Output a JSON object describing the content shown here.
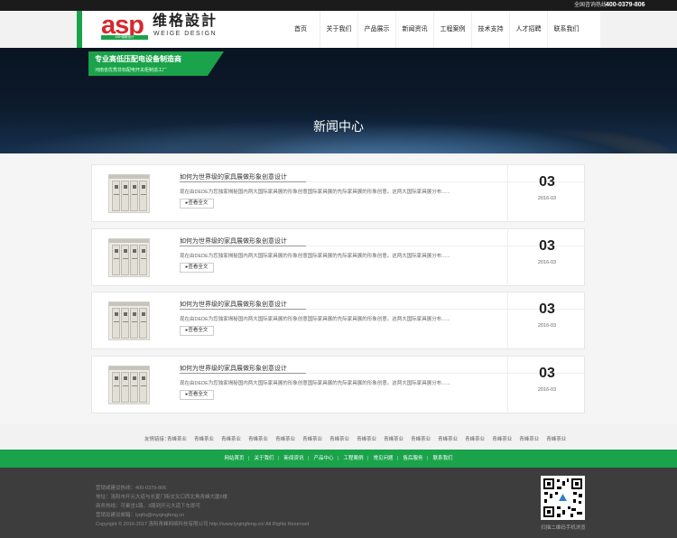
{
  "topbar": {
    "hotline_label": "全国咨询热线：",
    "hotline_number": "400-0379-806"
  },
  "logo": {
    "brand": "asp",
    "tagline": "ASP维格设计",
    "cn_name": "维格設計",
    "en_name": "WEIGE DESIGN"
  },
  "nav": {
    "items": [
      {
        "label": "首页"
      },
      {
        "label": "关于我们"
      },
      {
        "label": "产品展示"
      },
      {
        "label": "新闻资讯"
      },
      {
        "label": "工程案例"
      },
      {
        "label": "技术支持"
      },
      {
        "label": "人才招聘"
      },
      {
        "label": "联系我们"
      }
    ]
  },
  "banner": {
    "slogan": "专业高低压配电设备制造商",
    "slogan_sub": "河南省优秀非标配电开关柜制造工厂",
    "title": "新闻中心"
  },
  "news": [
    {
      "title": "如何为世界级的家具展做形象创意设计",
      "desc": "现在由DEDE为您独家揭秘国内两大国际家具展的形象创意国际家具展的先际家具展的形象创意。这两大国际家具展分布......",
      "more": "▸查看全文",
      "day": "03",
      "ym": "2016-03"
    },
    {
      "title": "如何为世界级的家具展做形象创意设计",
      "desc": "现在由DEDE为您独家揭秘国内两大国际家具展的形象创意国际家具展的先际家具展的形象创意。这两大国际家具展分布......",
      "more": "▸查看全文",
      "day": "03",
      "ym": "2016-03"
    },
    {
      "title": "如何为世界级的家具展做形象创意设计",
      "desc": "现在由DEDE为您独家揭秘国内两大国际家具展的形象创意国际家具展的先际家具展的形象创意。这两大国际家具展分布......",
      "more": "▸查看全文",
      "day": "03",
      "ym": "2016-03"
    },
    {
      "title": "如何为世界级的家具展做形象创意设计",
      "desc": "现在由DEDE为您独家揭秘国内两大国际家具展的形象创意国际家具展的先际家具展的形象创意。这两大国际家具展分布......",
      "more": "▸查看全文",
      "day": "03",
      "ym": "2016-03"
    }
  ],
  "friend_links": {
    "label": "友情链接：",
    "items": [
      "青峰茶业",
      "青峰茶业",
      "青峰茶业",
      "青峰茶业",
      "青峰茶业",
      "青峰茶业",
      "青峰茶业",
      "青峰茶业",
      "青峰茶业",
      "青峰茶业",
      "青峰茶业",
      "青峰茶业",
      "青峰茶业",
      "青峰茶业",
      "青峰茶业"
    ]
  },
  "footer_nav": {
    "items": [
      "网站首页",
      "关于我们",
      "新闻资讯",
      "产品中心",
      "工程案例",
      "常见问题",
      "售后服务",
      "联系我们"
    ]
  },
  "footer": {
    "lines": [
      "营销或建议热线：400-0379-806",
      "地址：洛阳市开元大道与长夏门街交叉口西北角青峰大厦6楼",
      "商务热线：可乘坐1路、3路到开元大道下车即可",
      "营销及建议邮箱：lyqifu@myqingfeng.cn",
      "Copyright © 2016-2017 洛阳青峰网络科技有限公司 http://www.lyqingfeng.cn/ All Rights Reserved"
    ],
    "qr_caption": "扫描二维码手机浏览"
  },
  "colors": {
    "accent": "#1aa34a",
    "brand_red": "#d7282f",
    "footer_bg": "#3d3d3d"
  }
}
